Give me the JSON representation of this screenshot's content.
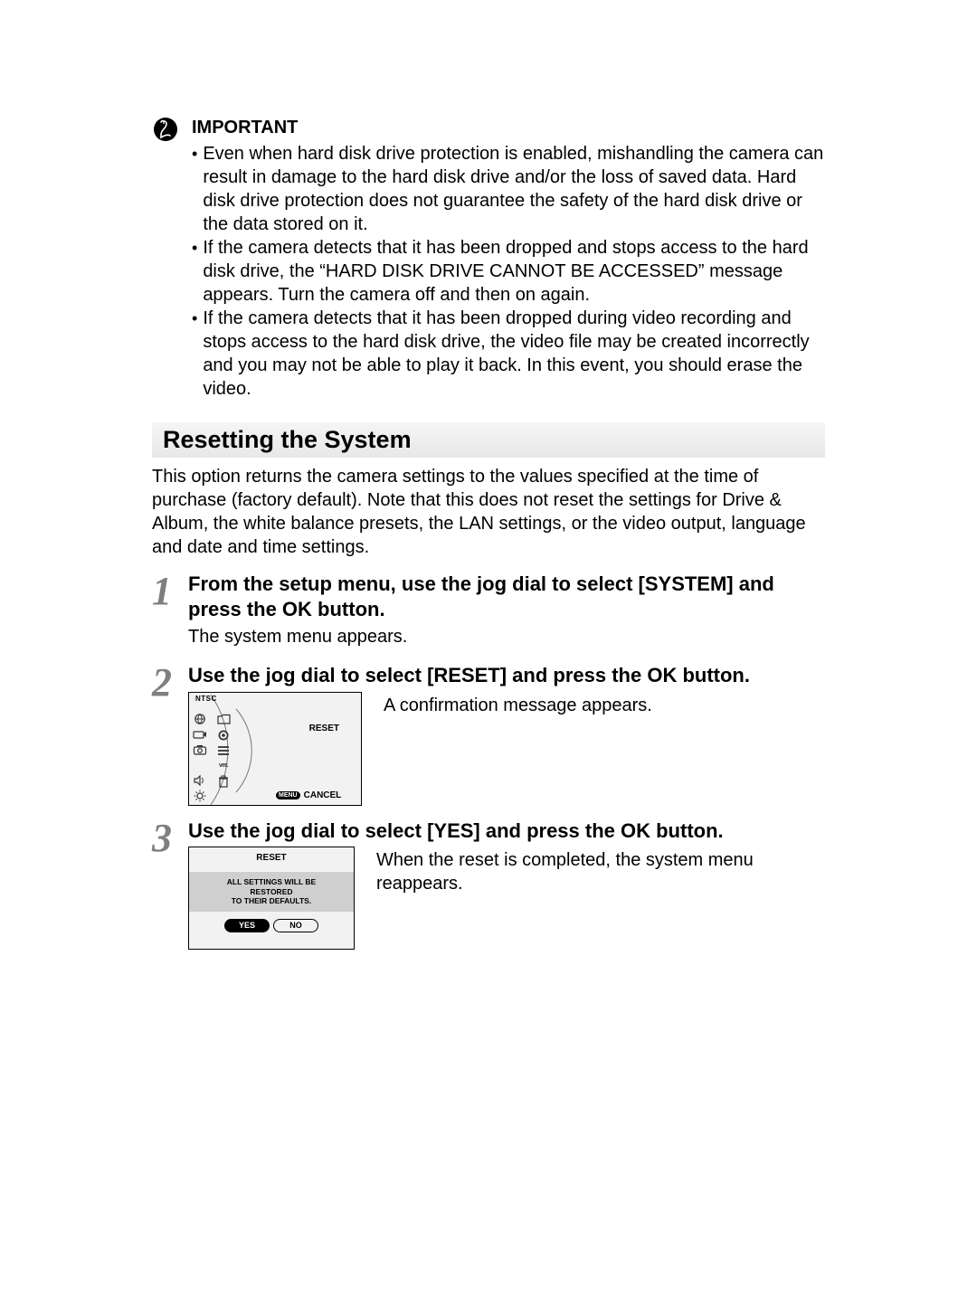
{
  "important": {
    "label": "IMPORTANT",
    "bullets": [
      "Even when hard disk drive protection is enabled, mishandling the camera can result in damage to the hard disk drive and/or the loss of saved data. Hard disk drive protection does not guarantee the safety of the hard disk drive or the data stored on it.",
      "If the camera detects that it has been dropped and stops access to the hard disk drive, the “HARD DISK DRIVE CANNOT BE ACCESSED” message appears. Turn the camera off and then on again.",
      "If the camera detects that it has been dropped during video recording and stops access to the hard disk drive, the video file may be created incorrectly and you may not be able to play it back. In this event, you should erase the video."
    ]
  },
  "section_heading": "Resetting the System",
  "intro": "This option returns the camera settings to the values specified at the time of purchase (factory default). Note that this does not reset the settings for Drive & Album, the white balance presets, the LAN settings, or the video output, language and date and time settings.",
  "steps": {
    "s1": {
      "num": "1",
      "title": "From the setup menu, use the jog dial to select [SYSTEM] and press the OK button.",
      "note": "The system menu appears."
    },
    "s2": {
      "num": "2",
      "title": "Use the jog dial to select [RESET] and press the OK button.",
      "screen": {
        "ntsc": "NTSC",
        "reset": "RESET",
        "menu_pill": "MENU",
        "cancel": "CANCEL"
      },
      "media_text": "A confirmation message appears."
    },
    "s3": {
      "num": "3",
      "title": "Use the jog dial to select [YES] and press the OK button.",
      "screen": {
        "title": "RESET",
        "message_line1": "ALL SETTINGS WILL BE",
        "message_line2": "RESTORED",
        "message_line3": "TO THEIR DEFAULTS.",
        "yes": "YES",
        "no": "NO"
      },
      "media_text": "When the reset is completed, the system menu reappears."
    }
  }
}
